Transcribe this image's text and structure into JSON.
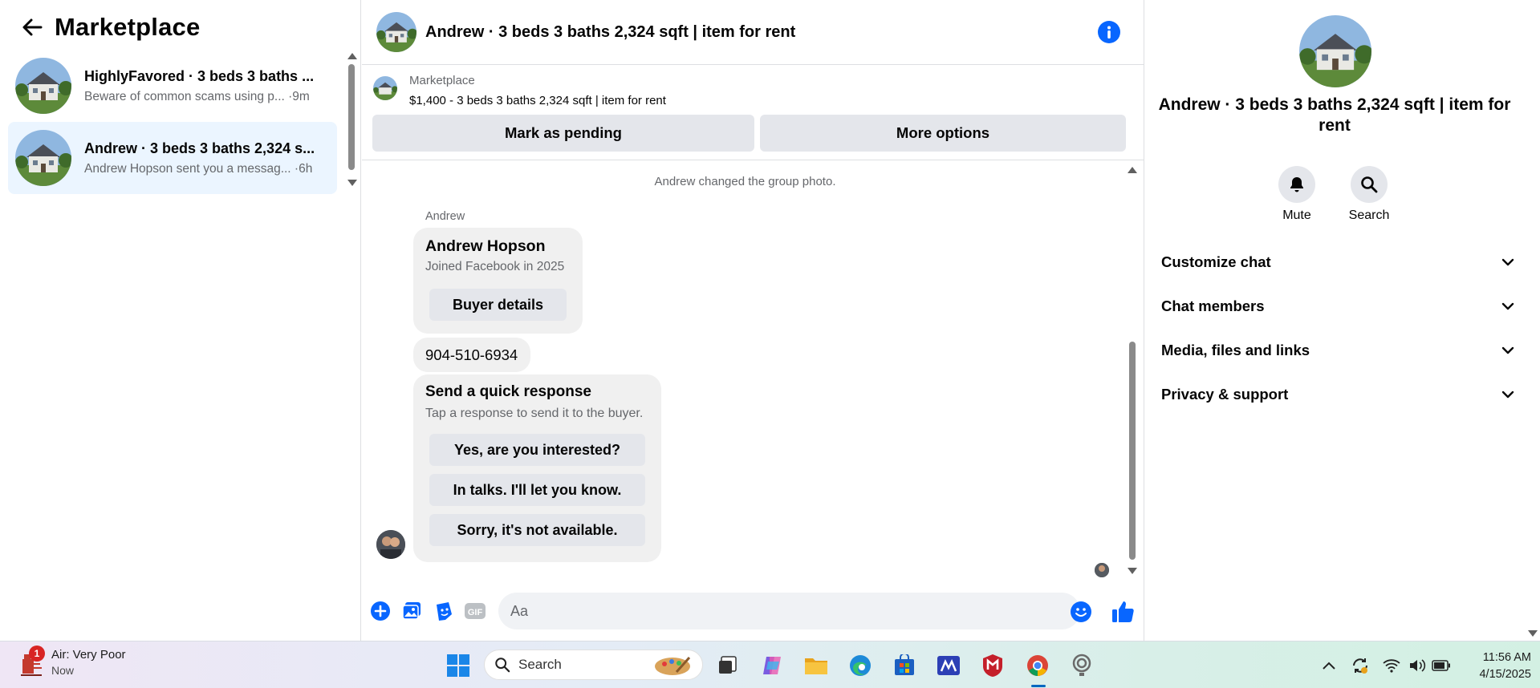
{
  "left": {
    "title": "Marketplace",
    "conversations": [
      {
        "name": "HighlyFavored · 3 beds 3 baths ...",
        "preview": "Beware of common scams using p... ·9m"
      },
      {
        "name": "Andrew · 3 beds 3 baths 2,324 s...",
        "preview": "Andrew Hopson sent you a messag... ·6h"
      }
    ]
  },
  "chat": {
    "header_title": "Andrew · 3 beds 3 baths 2,324 sqft | item for rent",
    "listing_source": "Marketplace",
    "listing_summary": "$1,400 - 3 beds 3 baths 2,324 sqft | item for rent",
    "mark_pending_label": "Mark as pending",
    "more_options_label": "More options",
    "system_message": "Andrew changed the group photo.",
    "sender_name": "Andrew",
    "profile_card": {
      "name": "Andrew Hopson",
      "joined": "Joined Facebook in 2025",
      "button": "Buyer details"
    },
    "phone_message": "904-510-6934",
    "quick_response": {
      "title": "Send a quick response",
      "subtitle": "Tap a response to send it to the buyer.",
      "options": [
        "Yes, are you interested?",
        "In talks. I'll let you know.",
        "Sorry, it's not available."
      ]
    },
    "composer_placeholder": "Aa"
  },
  "right": {
    "title": "Andrew · 3 beds 3 baths 2,324 sqft | item for rent",
    "actions": [
      {
        "label": "Mute",
        "icon": "bell-icon"
      },
      {
        "label": "Search",
        "icon": "search-icon"
      }
    ],
    "sections": [
      "Customize chat",
      "Chat members",
      "Media, files and links",
      "Privacy & support"
    ]
  },
  "taskbar": {
    "weather_badge": "1",
    "weather_title": "Air: Very Poor",
    "weather_sub": "Now",
    "search_label": "Search",
    "time": "11:56 AM",
    "date": "4/15/2025"
  },
  "colors": {
    "accent": "#0866ff",
    "active_conversation": "#ebf5ff",
    "bubble": "#f0f0f0",
    "button": "#e4e6eb"
  }
}
